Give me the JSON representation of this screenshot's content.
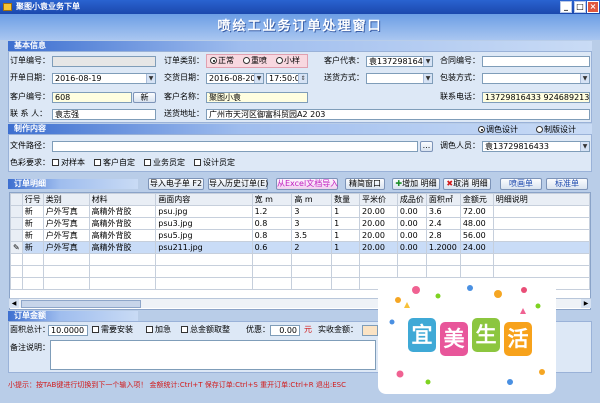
{
  "window": {
    "title": "聚图小袁业务下单"
  },
  "app_title": "喷绘工业务订单处理窗口",
  "basic_section": {
    "title": "基本信息"
  },
  "fields": {
    "order_no_label": "订单编号：",
    "order_no_value": "",
    "order_type_label": "订单类别：",
    "order_types": [
      "正常",
      "重喷",
      "小样"
    ],
    "cust_rep_label": "客户代表：",
    "cust_rep_value": "袁13729816433",
    "contract_label": "合同编号：",
    "contract_value": "",
    "open_date_label": "开单日期：",
    "open_date_value": "2016-08-19",
    "delivery_date_label": "交货日期：",
    "delivery_date_value": "2016-08-20",
    "delivery_time_value": "17:50:02",
    "delivery_method_label": "送货方式：",
    "delivery_method_value": "",
    "pack_method_label": "包装方式：",
    "pack_method_value": "",
    "cust_no_label": "客户编号：",
    "cust_no_value": "608",
    "new_btn": "新",
    "cust_name_label": "客户名称：",
    "cust_name_value": "聚图小袁",
    "contact_tel_label": "联系电话：",
    "contact_tel_value": "13729816433 924689213",
    "contact_label": "联 系 人：",
    "contact_value": "袁志强",
    "address_label": "送货地址：",
    "address_value": "广州市天河区御富科贸园A2 203"
  },
  "production_section": {
    "title": "制作内容"
  },
  "production": {
    "file_path_label": "文件路径：",
    "file_path_value": "",
    "browse_btn": "...",
    "design_radios": [
      "调色设计",
      "制版设计"
    ],
    "designer_label": "调色人员：",
    "designer_value": "袁13729816433",
    "color_req_label": "色彩要求：",
    "color_options": [
      "对样本",
      "客户自定",
      "业务员定",
      "设计员定"
    ]
  },
  "order_section": {
    "title": "订单明细"
  },
  "order_toolbar": {
    "import_pic": "导入电子单 F2",
    "import_history": "导入历史订单(E)",
    "import_excel": "从Excel文档导入",
    "clear": "精简窗口",
    "add_detail": "增加 明细",
    "cancel_detail": "取消 明细",
    "spray_tab": "喷画单",
    "sign_tab": "标准单"
  },
  "table": {
    "headers": [
      "行号",
      "类别",
      "材料",
      "画面内容",
      "宽 m",
      "高 m",
      "数量",
      "平米价",
      "成品价",
      "面积㎡",
      "金额元",
      "明细说明"
    ],
    "rows": [
      [
        "新",
        "户外写真",
        "高精外背胶",
        "psu.jpg",
        "1.2",
        "3",
        "1",
        "20.00",
        "0.00",
        "3.6",
        "72.00",
        ""
      ],
      [
        "新",
        "户外写真",
        "高精外背胶",
        "psu3.jpg",
        "0.8",
        "3",
        "1",
        "20.00",
        "0.00",
        "2.4",
        "48.00",
        ""
      ],
      [
        "新",
        "户外写真",
        "高精外背胶",
        "psu5.jpg",
        "0.8",
        "3.5",
        "1",
        "20.00",
        "0.00",
        "2.8",
        "56.00",
        ""
      ],
      [
        "新",
        "户外写真",
        "高精外背胶",
        "psu211.jpg",
        "0.6",
        "2",
        "1",
        "20.00",
        "0.00",
        "1.2000",
        "24.00",
        ""
      ]
    ]
  },
  "amount_section": {
    "title": "订单金额"
  },
  "amount": {
    "area_total_label": "面积总计：",
    "area_total_value": "10.0000",
    "install_label": "需要安装",
    "rush_label": "加急",
    "total_summary_label": "总金额取整",
    "discount_label": "优惠：",
    "discount_value": "0.00",
    "discount_unit": "元",
    "actual_label": "实收金额：",
    "actual_value": "",
    "remark_label": "备注说明："
  },
  "hint": "小提示：按TAB键进行切换到下一个输入项！ 金额统计:Ctrl+T 保存订单:Ctrl+S 重开订单:Ctrl+R 退出:ESC",
  "logo_text": "宜美生活"
}
